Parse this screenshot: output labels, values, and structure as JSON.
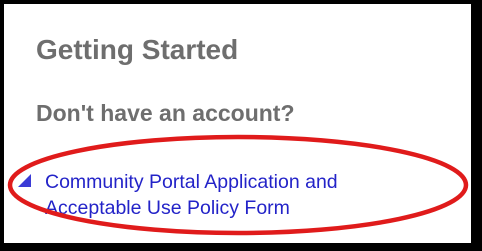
{
  "section": {
    "title": "Getting Started",
    "subtitle": "Don't have an account?"
  },
  "links": [
    {
      "line1": "Community Portal Application and",
      "line2": "Acceptable Use Policy Form",
      "icon": "triangle-bullet-icon"
    }
  ],
  "colors": {
    "heading": "#6e6e6e",
    "link": "#2323c8",
    "bullet": "#3b3bd6",
    "highlight_ellipse": "#e01b1b",
    "frame": "#000000"
  },
  "annotation": {
    "shape": "ellipse",
    "purpose": "highlight"
  }
}
